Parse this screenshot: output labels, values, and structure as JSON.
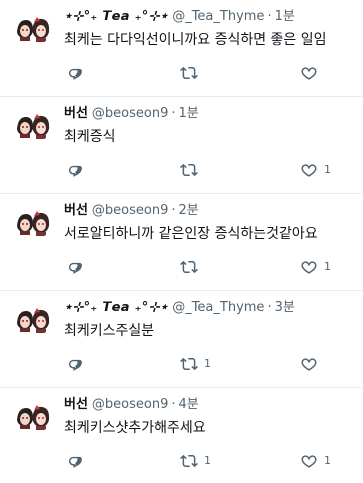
{
  "tweets": [
    {
      "avatar_icon": "duo-characters-avatar",
      "name": "⋆⊹°₊ 𝙏𝙚𝙖 ₊°⊹⋆",
      "handle": "@_Tea_Thyme",
      "separator": "·",
      "time": "1분",
      "text": "최케는 다다익선이니까요 증식하면 좋은 일임",
      "reply_count": "",
      "retweet_count": "",
      "like_count": ""
    },
    {
      "avatar_icon": "duo-characters-avatar",
      "name": "버선",
      "handle": "@beoseon9",
      "separator": "·",
      "time": "1분",
      "text": "최케증식",
      "reply_count": "",
      "retweet_count": "",
      "like_count": "1"
    },
    {
      "avatar_icon": "duo-characters-avatar",
      "name": "버선",
      "handle": "@beoseon9",
      "separator": "·",
      "time": "2분",
      "text": "서로알티하니까 같은인장 증식하는것같아요",
      "reply_count": "",
      "retweet_count": "",
      "like_count": "1"
    },
    {
      "avatar_icon": "duo-characters-avatar",
      "name": "⋆⊹°₊ 𝙏𝙚𝙖 ₊°⊹⋆",
      "handle": "@_Tea_Thyme",
      "separator": "·",
      "time": "3분",
      "text": "최케키스주실분",
      "reply_count": "",
      "retweet_count": "1",
      "like_count": ""
    },
    {
      "avatar_icon": "duo-characters-avatar",
      "name": "버선",
      "handle": "@beoseon9",
      "separator": "·",
      "time": "4분",
      "text": "최케키스샷추가해주세요",
      "reply_count": "",
      "retweet_count": "1",
      "like_count": "1"
    }
  ],
  "icons": {
    "reply": "reply-icon",
    "retweet": "retweet-icon",
    "like": "heart-icon"
  },
  "colors": {
    "text": "#0f1419",
    "muted": "#536471",
    "divider": "#e6ecf0"
  }
}
